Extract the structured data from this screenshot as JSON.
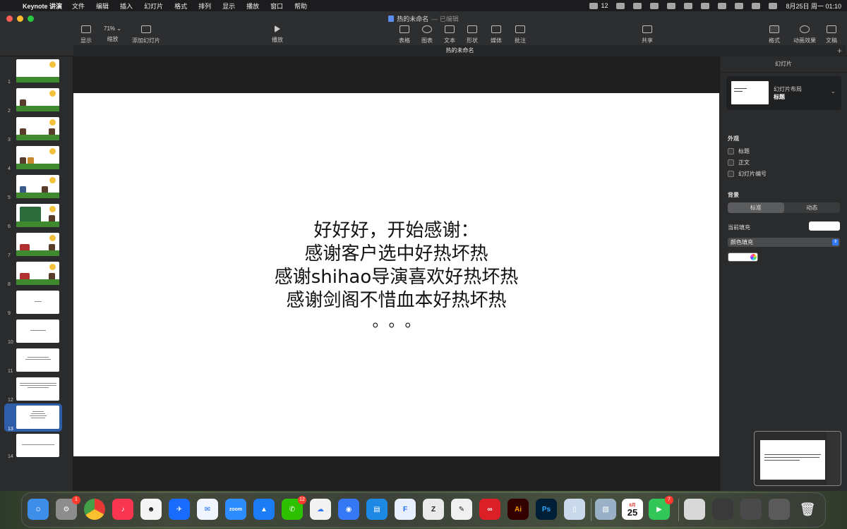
{
  "menubar": {
    "app_name": "Keynote 讲演",
    "items": [
      "文件",
      "编辑",
      "插入",
      "幻灯片",
      "格式",
      "排列",
      "显示",
      "播放",
      "窗口",
      "帮助"
    ],
    "wechat_count": "12",
    "datetime": "8月25日 周一 01:10"
  },
  "window": {
    "doc_title": "热的未命名",
    "edited_status": "— 已编辑",
    "tab_title": "热的未命名",
    "zoom": "71%"
  },
  "toolbar": {
    "view": "显示",
    "zoom": "缩放",
    "add_slide": "添加幻灯片",
    "play": "播放",
    "table": "表格",
    "chart": "图表",
    "text": "文本",
    "shape": "形状",
    "media": "媒体",
    "comment": "批注",
    "share": "共享",
    "format": "格式",
    "animate": "动画效果",
    "document": "文稿"
  },
  "slides": [
    {
      "num": "1"
    },
    {
      "num": "2"
    },
    {
      "num": "3"
    },
    {
      "num": "4"
    },
    {
      "num": "5"
    },
    {
      "num": "6"
    },
    {
      "num": "7"
    },
    {
      "num": "8"
    },
    {
      "num": "9"
    },
    {
      "num": "10"
    },
    {
      "num": "11"
    },
    {
      "num": "12"
    },
    {
      "num": "13"
    },
    {
      "num": "14"
    }
  ],
  "selected_slide": "13",
  "slide_content": {
    "line1": "好好好，开始感谢：",
    "line2": "感谢客户选中好热坏热",
    "line3": "感谢shihao导演喜欢好热坏热",
    "line4": "感谢剑阁不惜血本好热坏热",
    "dots": "。。。"
  },
  "inspector": {
    "header": "幻灯片",
    "layout_label": "幻灯片布局",
    "layout_value": "标题",
    "appearance_title": "外观",
    "check_title": "标题",
    "check_body": "正文",
    "check_number": "幻灯片编号",
    "background_title": "背景",
    "seg_standard": "标准",
    "seg_dynamic": "动态",
    "current_fill": "当前填充",
    "fill_type": "颜色填充"
  },
  "dock": {
    "settings_badge": "1",
    "wechat_badge": "12",
    "facetime_badge": "7",
    "calendar_month": "8月",
    "calendar_day": "25",
    "zoom_label": "zoom",
    "ai_label": "Ai",
    "ps_label": "Ps"
  }
}
